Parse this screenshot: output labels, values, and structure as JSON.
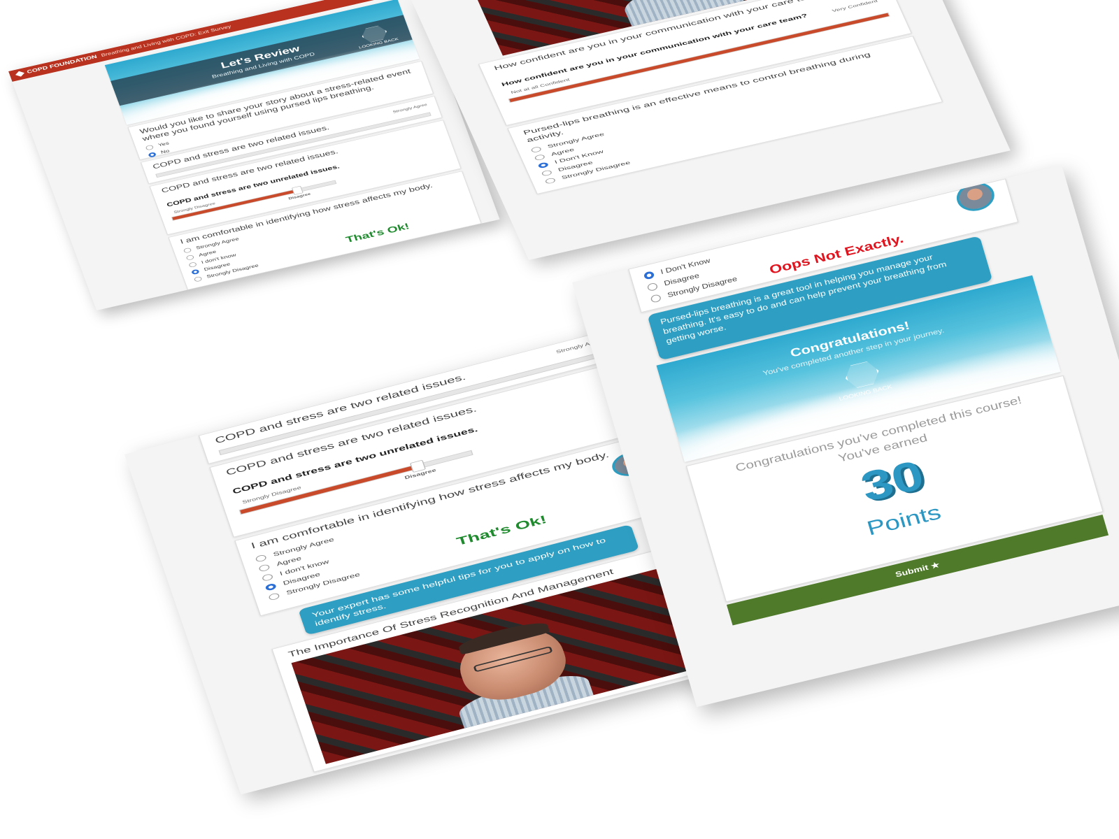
{
  "header": {
    "brand": "COPD FOUNDATION",
    "survey_title": "Breathing and Living with COPD: Exit Survey"
  },
  "hero": {
    "title": "Let's Review",
    "subtitle": "Breathing and Living with COPD",
    "badge": "LOOKING BACK"
  },
  "questions": {
    "share_story": "Would you like to share your story about a stress-related event where you found yourself using pursed lips breathing.",
    "share_options": [
      "Yes",
      "No"
    ],
    "related_issues": "COPD and stress are two related issues.",
    "related_scale_right": "Strongly Agree",
    "unrelated_issues": "COPD and stress are two unrelated issues.",
    "unrelated_scale_left": "Strongly Disagree",
    "unrelated_value": "Disagree",
    "unrelated_level": 0.75,
    "comfortable": "I am comfortable in identifying how stress affects my body.",
    "comfortable_options": [
      "Strongly Agree",
      "Agree",
      "I don't know",
      "Disagree",
      "Strongly Disagree"
    ],
    "comfortable_selected": 3,
    "confident": "How confident are you in your communication with your care team?",
    "confident_bold": "How confident are you in your communication with your care team?",
    "confident_left": "Not at all Confident",
    "confident_right": "Very Confident",
    "confident_level": 1.0,
    "pursed": "Pursed-lips breathing is an effective means to control breathing during activity.",
    "pursed_options": [
      "Strongly Agree",
      "Agree",
      "I Don't Know",
      "Disagree",
      "Strongly Disagree"
    ],
    "pursed_selected": 2
  },
  "feedback": {
    "thats_ok": "That's Ok!",
    "expert_tip": "Your expert has some helpful tips for you to apply on how to identify stress.",
    "oops": "Oops Not Exactly.",
    "pursed_tip": "Pursed-lips breathing is a great tool in helping you manage your breathing. It's easy to do and can help prevent your breathing from getting worse.",
    "pursed_selected_label": "I Don't Know",
    "pursed_remaining": [
      "Disagree",
      "Strongly Disagree"
    ]
  },
  "video": {
    "title": "The Importance Of Stress Recognition And Management"
  },
  "completion": {
    "banner_title": "Congratulations!",
    "banner_subtitle": "You've completed another step in your journey.",
    "badge": "LOOKING BACK",
    "message_line1": "Congratulations you've completed this course!",
    "message_line2": "You've earned",
    "points_value": "30",
    "points_label": "Points",
    "submit_label": "Submit ★"
  },
  "colors": {
    "brand_red": "#b8321f",
    "accent_blue": "#2e9fc3",
    "slider_fill": "#c94a2b",
    "ok_green": "#1f8a2e",
    "oops_red": "#e0141f",
    "submit_green": "#4f7a2a"
  }
}
